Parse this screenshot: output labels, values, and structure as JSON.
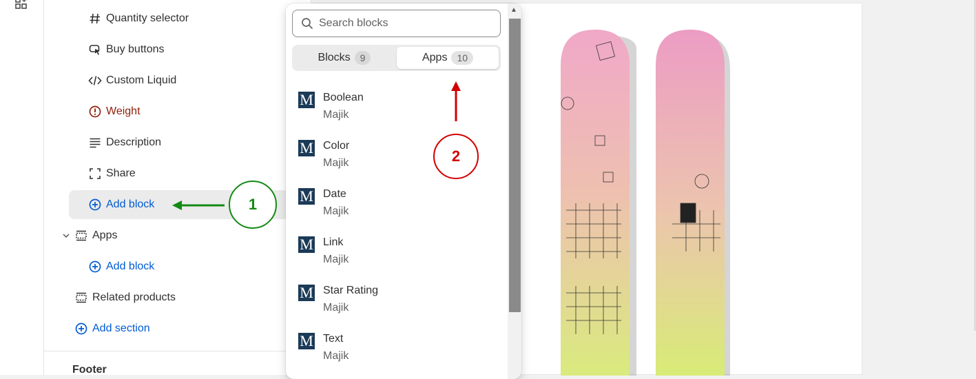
{
  "sidebar": {
    "items": [
      {
        "label": "Quantity selector",
        "icon": "hash-icon"
      },
      {
        "label": "Buy buttons",
        "icon": "cursor-button-icon"
      },
      {
        "label": "Custom Liquid",
        "icon": "code-icon"
      },
      {
        "label": "Weight",
        "icon": "alert-circle-icon"
      },
      {
        "label": "Description",
        "icon": "text-align-icon"
      },
      {
        "label": "Share",
        "icon": "share-frame-icon"
      }
    ],
    "add_block_label": "Add block",
    "apps_label": "Apps",
    "apps_add_block_label": "Add block",
    "related_products_label": "Related products",
    "add_section_label": "Add section",
    "footer_label": "Footer"
  },
  "popover": {
    "search_placeholder": "Search blocks",
    "tabs": [
      {
        "label": "Blocks",
        "count": "9"
      },
      {
        "label": "Apps",
        "count": "10"
      }
    ],
    "apps": [
      {
        "name": "Boolean",
        "vendor": "Majik"
      },
      {
        "name": "Color",
        "vendor": "Majik"
      },
      {
        "name": "Date",
        "vendor": "Majik"
      },
      {
        "name": "Link",
        "vendor": "Majik"
      },
      {
        "name": "Star Rating",
        "vendor": "Majik"
      },
      {
        "name": "Text",
        "vendor": "Majik"
      }
    ],
    "logo_letter": "M"
  },
  "annotations": {
    "step1": "1",
    "step2": "2",
    "step1_color": "#138a13",
    "step2_color": "#d10000"
  },
  "colors": {
    "accent_blue": "#005bd3",
    "alert_red": "#8e1f0b",
    "app_logo": "#1b3a57"
  }
}
